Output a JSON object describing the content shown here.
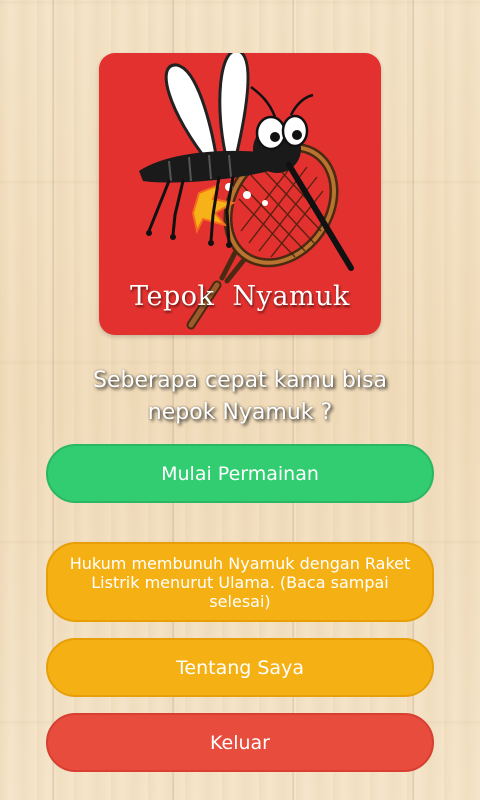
{
  "logo": {
    "title": "Tepok  Nyamuk",
    "background_color": "#e2312e",
    "icon": "mosquito-with-racket-illustration"
  },
  "tagline": {
    "line1": "Seberapa cepat kamu bisa",
    "line2": "nepok Nyamuk ?"
  },
  "buttons": {
    "start": {
      "label": "Mulai Permainan",
      "color": "#32cc71"
    },
    "hukum": {
      "label": "Hukum membunuh Nyamuk dengan Raket Listrik menurut Ulama. (Baca sampai selesai)",
      "color": "#f5b114"
    },
    "about": {
      "label": "Tentang Saya",
      "color": "#f5b114"
    },
    "exit": {
      "label": "Keluar",
      "color": "#e84c3d"
    }
  }
}
